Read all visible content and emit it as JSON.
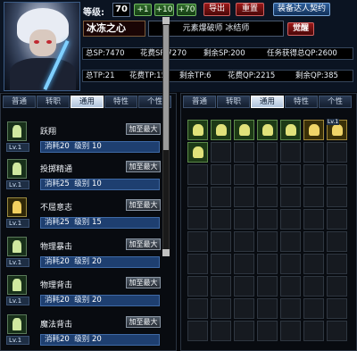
{
  "character": {
    "level_label": "等级:",
    "level": "70",
    "name": "冰冻之心",
    "class_name": "元素爆破师 冰结师"
  },
  "header_buttons": {
    "plus1": "+1",
    "plus10": "+10",
    "plus70": "+70",
    "export": "导出",
    "reset": "重置",
    "contract": "装备达人契约",
    "awaken": "觉醒"
  },
  "stats": {
    "total_sp": "总SP:7470",
    "spent_sp": "花费SP:7270",
    "remaining_sp": "剩余SP:200",
    "quest_qp": "任务获得总QP:2600",
    "total_tp": "总TP:21",
    "spent_tp": "花费TP:15",
    "remaining_tp": "剩余TP:6",
    "spent_qp": "花费QP:2215",
    "remaining_qp": "剩余QP:385"
  },
  "left_tabs": [
    "普通",
    "转职",
    "通用",
    "特性",
    "个性"
  ],
  "right_tabs": [
    "普通",
    "转职",
    "通用",
    "特性",
    "个性"
  ],
  "active_tab": "通用",
  "skills": [
    {
      "name": "跃翔",
      "lv": "Lv.1",
      "cost_label": "消耗",
      "cost": "20",
      "level_label": "级别",
      "level": "10",
      "max_label": "加至最大"
    },
    {
      "name": "投掷精通",
      "lv": "Lv.1",
      "cost_label": "消耗",
      "cost": "25",
      "level_label": "级别",
      "level": "10",
      "max_label": "加至最大"
    },
    {
      "name": "不屈意志",
      "lv": "Lv.1",
      "cost_label": "消耗",
      "cost": "25",
      "level_label": "级别",
      "level": "15",
      "max_label": "加至最大"
    },
    {
      "name": "物理暴击",
      "lv": "Lv.1",
      "cost_label": "消耗",
      "cost": "20",
      "level_label": "级别",
      "level": "20",
      "max_label": "加至最大"
    },
    {
      "name": "物理背击",
      "lv": "Lv.1",
      "cost_label": "消耗",
      "cost": "20",
      "level_label": "级别",
      "level": "20",
      "max_label": "加至最大"
    },
    {
      "name": "魔法背击",
      "lv": "Lv.1",
      "cost_label": "消耗",
      "cost": "20",
      "level_label": "级别",
      "level": "20",
      "max_label": "加至最大"
    }
  ],
  "grid_badges": {
    "lv1": "Lv.1"
  },
  "colors": {
    "active_tab": "#e6eef8",
    "stat_bar": "#1e3f70",
    "export_button": "#9a1818",
    "contract_button": "#2c5d9a"
  }
}
